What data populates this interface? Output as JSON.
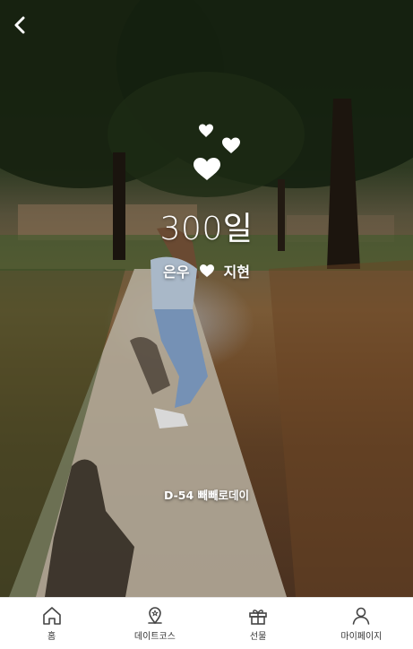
{
  "header": {
    "back_icon": "chevron-left-icon"
  },
  "anniversary": {
    "title": "300일",
    "partner_left": "은우",
    "partner_right": "지현",
    "separator_icon": "heart-icon",
    "countdown": "D-54 빼빼로데이"
  },
  "tabbar": {
    "items": [
      {
        "label": "홈",
        "icon": "home-icon"
      },
      {
        "label": "데이트코스",
        "icon": "map-pin-icon"
      },
      {
        "label": "선물",
        "icon": "gift-icon"
      },
      {
        "label": "마이페이지",
        "icon": "user-icon"
      }
    ]
  },
  "colors": {
    "text_on_photo": "#ffffff",
    "tab_icon": "#444444",
    "tab_label": "#333333"
  }
}
